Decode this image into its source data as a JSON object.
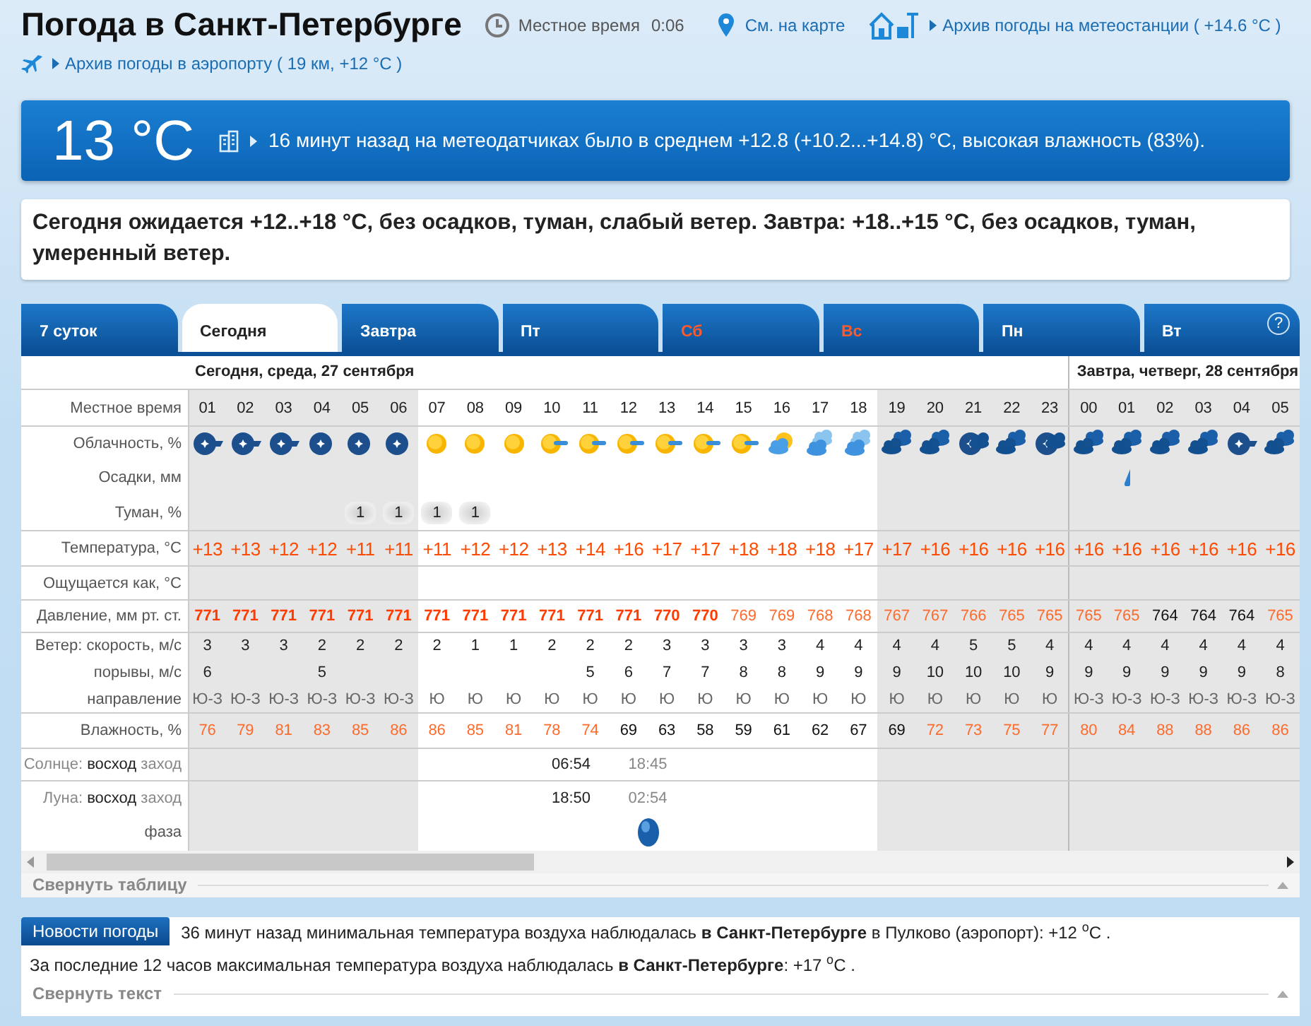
{
  "header": {
    "title": "Погода в Санкт-Петербурге",
    "time_label": "Местное время",
    "time": "0:06",
    "map_link": "См. на карте",
    "station_link": "Архив погоды на метеостанции ( +14.6 °C )",
    "airport_link": "Архив погоды в аэропорту ( 19 км, +12 °C )"
  },
  "current": {
    "temp": "13 °C",
    "text": "16 минут назад на метеодатчиках было в среднем +12.8 (+10.2...+14.8) °C, высокая влажность (83%)."
  },
  "forecast": "Сегодня ожидается +12..+18 °C, без осадков, туман, слабый ветер. Завтра: +18..+15 °C, без осадков, туман, умеренный ветер.",
  "tabs": [
    {
      "label": "7 суток",
      "selected": false,
      "weekend": false
    },
    {
      "label": "Сегодня",
      "selected": true,
      "weekend": false
    },
    {
      "label": "Завтра",
      "selected": false,
      "weekend": false
    },
    {
      "label": "Пт",
      "selected": false,
      "weekend": false
    },
    {
      "label": "Сб",
      "selected": false,
      "weekend": true
    },
    {
      "label": "Вс",
      "selected": false,
      "weekend": true
    },
    {
      "label": "Пн",
      "selected": false,
      "weekend": false
    },
    {
      "label": "Вт",
      "selected": false,
      "weekend": false
    }
  ],
  "help": "?",
  "rows": [
    {
      "kind": "time",
      "label": "Местное время"
    },
    {
      "kind": "sky",
      "label": "Облачность, %"
    },
    {
      "kind": "rain",
      "label": "Осадки, мм"
    },
    {
      "kind": "fog",
      "label": "Туман, %"
    },
    {
      "kind": "temp",
      "label": "Температура, °C"
    },
    {
      "kind": "feels",
      "label": "Ощущается как, °C"
    },
    {
      "kind": "pressure",
      "label": "Давление, мм рт. ст."
    },
    {
      "kind": "wind",
      "label": "Ветер: скорость, м/с"
    },
    {
      "kind": "gust",
      "label": "порывы, м/с"
    },
    {
      "kind": "dir",
      "label": "направление"
    },
    {
      "kind": "humidity",
      "label": "Влажность, %"
    },
    {
      "kind": "sun",
      "parts": [
        "Солнце:",
        "восход",
        "заход"
      ]
    },
    {
      "kind": "moon",
      "parts": [
        "Луна:",
        "восход",
        "заход"
      ]
    },
    {
      "kind": "phase",
      "label": "фаза"
    }
  ],
  "days": [
    {
      "title": "Сегодня, среда, 27 сентября",
      "hours": [
        {
          "t": "01",
          "night": true,
          "sky": {
            "kind": "moon-cloud"
          },
          "temp": "+13",
          "pressure": {
            "value": "771",
            "color": "#ff3b00",
            "bold": true
          },
          "wind": "3",
          "gust": "6",
          "dir": "Ю-З",
          "humidity": {
            "value": "76",
            "color": "#ff6a2a"
          }
        },
        {
          "t": "02",
          "night": true,
          "sky": {
            "kind": "moon-cloud"
          },
          "temp": "+13",
          "pressure": {
            "value": "771",
            "color": "#ff3b00",
            "bold": true
          },
          "wind": "3",
          "dir": "Ю-З",
          "humidity": {
            "value": "79",
            "color": "#ff6a2a"
          }
        },
        {
          "t": "03",
          "night": true,
          "sky": {
            "kind": "moon-cloud"
          },
          "temp": "+12",
          "pressure": {
            "value": "771",
            "color": "#ff3b00",
            "bold": true
          },
          "wind": "3",
          "dir": "Ю-З",
          "humidity": {
            "value": "81",
            "color": "#ff6a2a"
          }
        },
        {
          "t": "04",
          "night": true,
          "sky": {
            "kind": "moon"
          },
          "temp": "+12",
          "pressure": {
            "value": "771",
            "color": "#ff3b00",
            "bold": true
          },
          "wind": "2",
          "gust": "5",
          "dir": "Ю-З",
          "humidity": {
            "value": "83",
            "color": "#ff6a2a"
          }
        },
        {
          "t": "05",
          "night": true,
          "sky": {
            "kind": "moon"
          },
          "fog": "1",
          "temp": "+11",
          "pressure": {
            "value": "771",
            "color": "#ff3b00",
            "bold": true
          },
          "wind": "2",
          "dir": "Ю-З",
          "humidity": {
            "value": "85",
            "color": "#ff6a2a"
          }
        },
        {
          "t": "06",
          "night": true,
          "sky": {
            "kind": "moon"
          },
          "fog": "1",
          "temp": "+11",
          "pressure": {
            "value": "771",
            "color": "#ff3b00",
            "bold": true
          },
          "wind": "2",
          "dir": "Ю-З",
          "humidity": {
            "value": "86",
            "color": "#ff6a2a"
          }
        },
        {
          "t": "07",
          "night": false,
          "sky": {
            "kind": "sun"
          },
          "fog": "1",
          "temp": "+11",
          "pressure": {
            "value": "771",
            "color": "#ff3b00",
            "bold": true
          },
          "wind": "2",
          "dir": "Ю",
          "humidity": {
            "value": "86",
            "color": "#ff6a2a"
          }
        },
        {
          "t": "08",
          "night": false,
          "sky": {
            "kind": "sun"
          },
          "fog": "1",
          "temp": "+12",
          "pressure": {
            "value": "771",
            "color": "#ff3b00",
            "bold": true
          },
          "wind": "1",
          "dir": "Ю",
          "humidity": {
            "value": "85",
            "color": "#ff6a2a"
          }
        },
        {
          "t": "09",
          "night": false,
          "sky": {
            "kind": "sun"
          },
          "temp": "+12",
          "pressure": {
            "value": "771",
            "color": "#ff3b00",
            "bold": true
          },
          "wind": "1",
          "dir": "Ю",
          "humidity": {
            "value": "81",
            "color": "#ff6a2a"
          }
        },
        {
          "t": "10",
          "night": false,
          "sky": {
            "kind": "sun-cloud"
          },
          "temp": "+13",
          "pressure": {
            "value": "771",
            "color": "#ff3b00",
            "bold": true
          },
          "wind": "2",
          "dir": "Ю",
          "humidity": {
            "value": "78",
            "color": "#ff6a2a"
          },
          "sunrise": "06:54",
          "moonrise": "18:50"
        },
        {
          "t": "11",
          "night": false,
          "sky": {
            "kind": "sun-cloud"
          },
          "temp": "+14",
          "pressure": {
            "value": "771",
            "color": "#ff3b00",
            "bold": true
          },
          "wind": "2",
          "gust": "5",
          "dir": "Ю",
          "humidity": {
            "value": "74",
            "color": "#ff6a2a"
          }
        },
        {
          "t": "12",
          "night": false,
          "sky": {
            "kind": "sun-cloud"
          },
          "temp": "+16",
          "pressure": {
            "value": "771",
            "color": "#ff3b00",
            "bold": true
          },
          "wind": "2",
          "gust": "6",
          "dir": "Ю",
          "humidity": {
            "value": "69",
            "color": "#111111"
          },
          "sunset": "18:45",
          "moonset": "02:54",
          "moon_phase": true
        },
        {
          "t": "13",
          "night": false,
          "sky": {
            "kind": "sun-cloud"
          },
          "temp": "+17",
          "pressure": {
            "value": "770",
            "color": "#ff3b00",
            "bold": true
          },
          "wind": "3",
          "gust": "7",
          "dir": "Ю",
          "humidity": {
            "value": "63",
            "color": "#111111"
          }
        },
        {
          "t": "14",
          "night": false,
          "sky": {
            "kind": "sun-cloud"
          },
          "temp": "+17",
          "pressure": {
            "value": "770",
            "color": "#ff3b00",
            "bold": true
          },
          "wind": "3",
          "gust": "7",
          "dir": "Ю",
          "humidity": {
            "value": "58",
            "color": "#111111"
          }
        },
        {
          "t": "15",
          "night": false,
          "sky": {
            "kind": "sun-cloud"
          },
          "temp": "+18",
          "pressure": {
            "value": "769",
            "color": "#ff6a2a",
            "bold": false
          },
          "wind": "3",
          "gust": "8",
          "dir": "Ю",
          "humidity": {
            "value": "59",
            "color": "#111111"
          }
        },
        {
          "t": "16",
          "night": false,
          "sky": {
            "kind": "cloud-sun"
          },
          "temp": "+18",
          "pressure": {
            "value": "769",
            "color": "#ff6a2a",
            "bold": false
          },
          "wind": "3",
          "gust": "8",
          "dir": "Ю",
          "humidity": {
            "value": "61",
            "color": "#111111"
          }
        },
        {
          "t": "17",
          "night": false,
          "sky": {
            "kind": "clouds"
          },
          "temp": "+18",
          "pressure": {
            "value": "768",
            "color": "#ff6a2a",
            "bold": false
          },
          "wind": "4",
          "gust": "9",
          "dir": "Ю",
          "humidity": {
            "value": "62",
            "color": "#111111"
          }
        },
        {
          "t": "18",
          "night": false,
          "sky": {
            "kind": "clouds"
          },
          "temp": "+17",
          "pressure": {
            "value": "768",
            "color": "#ff6a2a",
            "bold": false
          },
          "wind": "4",
          "gust": "9",
          "dir": "Ю",
          "humidity": {
            "value": "67",
            "color": "#111111"
          }
        },
        {
          "t": "19",
          "night": true,
          "sky": {
            "kind": "dark-clouds"
          },
          "temp": "+17",
          "pressure": {
            "value": "767",
            "color": "#ff6a2a",
            "bold": false
          },
          "wind": "4",
          "gust": "9",
          "dir": "Ю",
          "humidity": {
            "value": "69",
            "color": "#111111"
          }
        },
        {
          "t": "20",
          "night": true,
          "sky": {
            "kind": "dark-clouds"
          },
          "temp": "+16",
          "pressure": {
            "value": "767",
            "color": "#ff6a2a",
            "bold": false
          },
          "wind": "4",
          "gust": "10",
          "dir": "Ю",
          "humidity": {
            "value": "72",
            "color": "#ff6a2a"
          }
        },
        {
          "t": "21",
          "night": true,
          "sky": {
            "kind": "moon-dark"
          },
          "temp": "+16",
          "pressure": {
            "value": "766",
            "color": "#ff6a2a",
            "bold": false
          },
          "wind": "5",
          "gust": "10",
          "dir": "Ю",
          "humidity": {
            "value": "73",
            "color": "#ff6a2a"
          }
        },
        {
          "t": "22",
          "night": true,
          "sky": {
            "kind": "dark-clouds"
          },
          "temp": "+16",
          "pressure": {
            "value": "765",
            "color": "#ff6a2a",
            "bold": false
          },
          "wind": "5",
          "gust": "10",
          "dir": "Ю",
          "humidity": {
            "value": "75",
            "color": "#ff6a2a"
          }
        },
        {
          "t": "23",
          "night": true,
          "sky": {
            "kind": "moon-dark"
          },
          "temp": "+16",
          "pressure": {
            "value": "765",
            "color": "#ff6a2a",
            "bold": false
          },
          "wind": "4",
          "gust": "9",
          "dir": "Ю",
          "humidity": {
            "value": "77",
            "color": "#ff6a2a"
          }
        }
      ]
    },
    {
      "title": "Завтра, четверг, 28 сентября",
      "hours": [
        {
          "t": "00",
          "night": true,
          "sky": {
            "kind": "dark-clouds"
          },
          "temp": "+16",
          "pressure": {
            "value": "765",
            "color": "#ff6a2a",
            "bold": false
          },
          "wind": "4",
          "gust": "9",
          "dir": "Ю-З",
          "humidity": {
            "value": "80",
            "color": "#ff6a2a"
          }
        },
        {
          "t": "01",
          "night": true,
          "sky": {
            "kind": "dark-clouds"
          },
          "rain": true,
          "temp": "+16",
          "pressure": {
            "value": "765",
            "color": "#ff6a2a",
            "bold": false
          },
          "wind": "4",
          "gust": "9",
          "dir": "Ю-З",
          "humidity": {
            "value": "84",
            "color": "#ff6a2a"
          }
        },
        {
          "t": "02",
          "night": true,
          "sky": {
            "kind": "dark-clouds"
          },
          "temp": "+16",
          "pressure": {
            "value": "764",
            "color": "#111111",
            "bold": false
          },
          "wind": "4",
          "gust": "9",
          "dir": "Ю-З",
          "humidity": {
            "value": "88",
            "color": "#ff6a2a"
          }
        },
        {
          "t": "03",
          "night": true,
          "sky": {
            "kind": "dark-clouds"
          },
          "temp": "+16",
          "pressure": {
            "value": "764",
            "color": "#111111",
            "bold": false
          },
          "wind": "4",
          "gust": "9",
          "dir": "Ю-З",
          "humidity": {
            "value": "88",
            "color": "#ff6a2a"
          }
        },
        {
          "t": "04",
          "night": true,
          "sky": {
            "kind": "moon-cloud"
          },
          "temp": "+16",
          "pressure": {
            "value": "764",
            "color": "#111111",
            "bold": false
          },
          "wind": "4",
          "gust": "9",
          "dir": "Ю-З",
          "humidity": {
            "value": "86",
            "color": "#ff6a2a"
          }
        },
        {
          "t": "05",
          "night": true,
          "sky": {
            "kind": "dark-clouds"
          },
          "temp": "+16",
          "pressure": {
            "value": "765",
            "color": "#ff6a2a",
            "bold": false
          },
          "wind": "4",
          "gust": "8",
          "dir": "Ю-З",
          "humidity": {
            "value": "86",
            "color": "#ff6a2a"
          }
        }
      ]
    }
  ],
  "collapse_table": "Свернуть таблицу",
  "news": {
    "badge": "Новости погоды",
    "lines": [
      "36 минут назад минимальная температура воздуха наблюдалась **в Санкт-Петербурге** в Пулково (аэропорт): +12 $^{o}$C .",
      "За последние 12 часов максимальная температура воздуха наблюдалась **в Санкт-Петербурге**: +17 $^{o}$C ."
    ],
    "collapse": "Свернуть текст"
  }
}
